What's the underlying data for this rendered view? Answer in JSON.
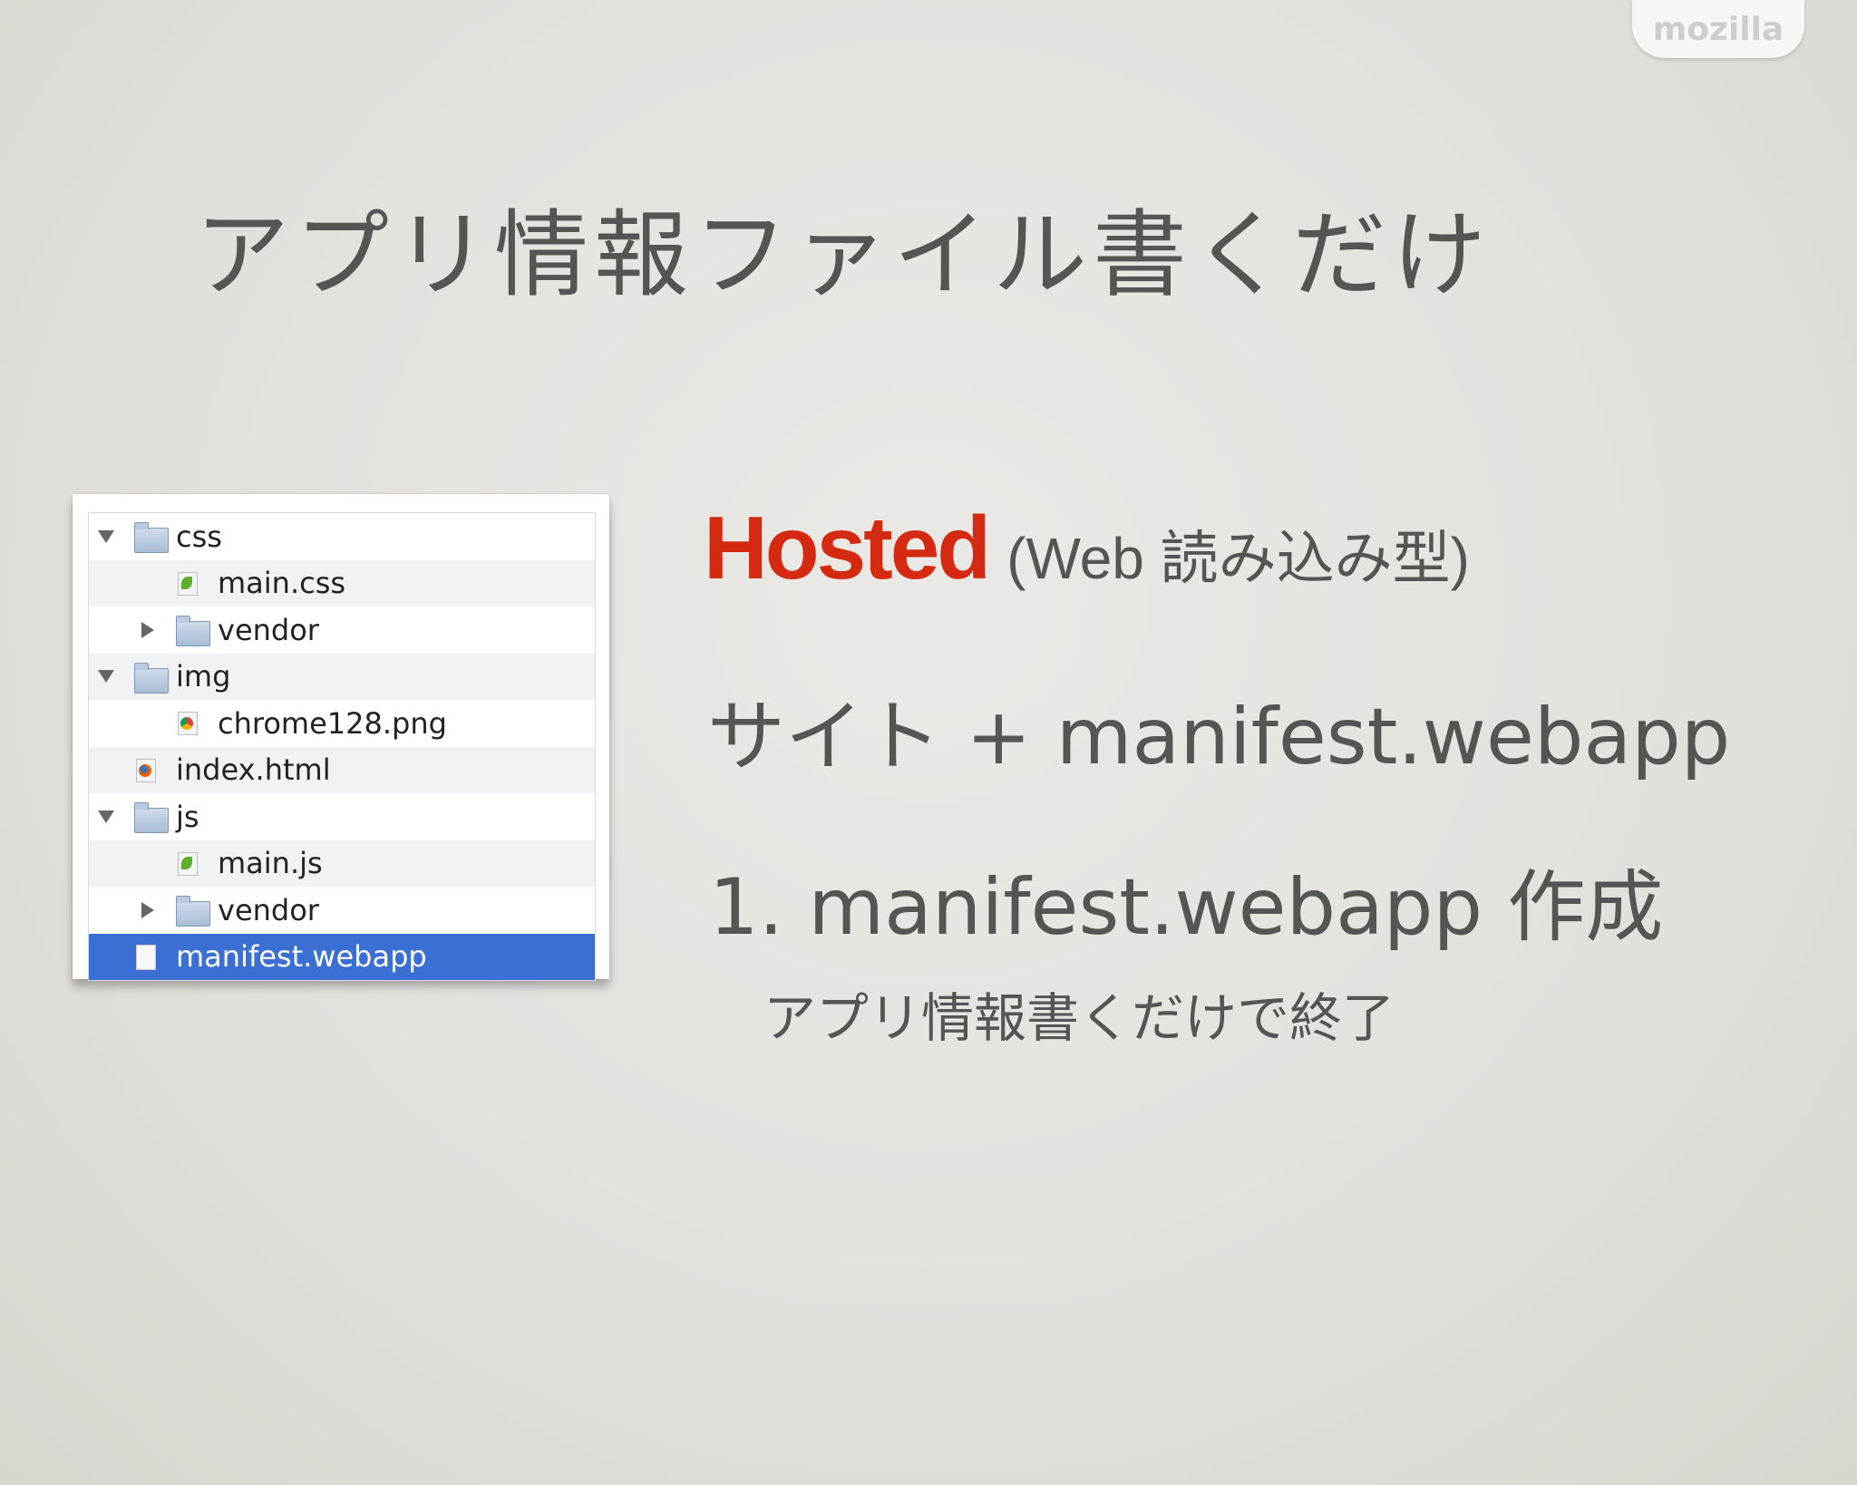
{
  "brand": {
    "logo_text": "mozilla"
  },
  "slide": {
    "title": "アプリ情報ファイル書くだけ",
    "hosted_word": "Hosted",
    "hosted_note": "(Web 読み込み型)",
    "line_site": "サイト + manifest.webapp",
    "line_step1": "1. manifest.webapp 作成",
    "line_step1_sub": "アプリ情報書くだけで終了"
  },
  "file_tree": {
    "rows": [
      {
        "label": "css",
        "kind": "folder",
        "state": "expanded"
      },
      {
        "label": "main.css",
        "kind": "leaf-file"
      },
      {
        "label": "vendor",
        "kind": "folder",
        "state": "collapsed"
      },
      {
        "label": "img",
        "kind": "folder",
        "state": "expanded"
      },
      {
        "label": "chrome128.png",
        "kind": "chrome-file"
      },
      {
        "label": "index.html",
        "kind": "firefox-file"
      },
      {
        "label": "js",
        "kind": "folder",
        "state": "expanded"
      },
      {
        "label": "main.js",
        "kind": "leaf-file"
      },
      {
        "label": "vendor",
        "kind": "folder",
        "state": "collapsed"
      },
      {
        "label": "manifest.webapp",
        "kind": "plain-file",
        "selected": true
      }
    ]
  },
  "colors": {
    "accent_red": "#d52a12",
    "selection_blue": "#3b6fd4",
    "text_gray": "#555555"
  }
}
